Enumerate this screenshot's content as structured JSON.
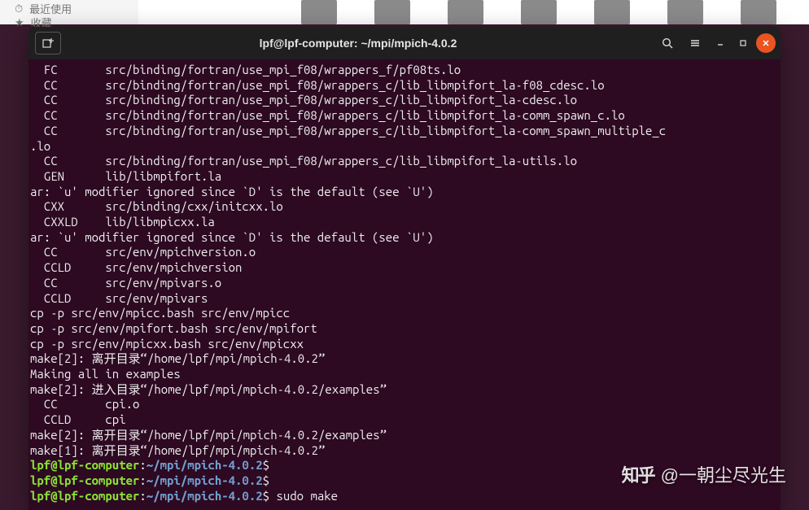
{
  "bg": {
    "sidebar": {
      "recent": "最近使用",
      "fav": "收藏"
    }
  },
  "titlebar": {
    "title": "lpf@lpf-computer: ~/mpi/mpich-4.0.2",
    "newtab_icon": "new-tab-icon",
    "search_icon": "search-icon",
    "menu_icon": "menu-icon",
    "min_icon": "minimize-icon",
    "max_icon": "maximize-icon",
    "close_icon": "close-icon"
  },
  "term": {
    "lines": [
      "  FC       src/binding/fortran/use_mpi_f08/wrappers_f/pf08ts.lo",
      "  CC       src/binding/fortran/use_mpi_f08/wrappers_c/lib_libmpifort_la-f08_cdesc.lo",
      "  CC       src/binding/fortran/use_mpi_f08/wrappers_c/lib_libmpifort_la-cdesc.lo",
      "  CC       src/binding/fortran/use_mpi_f08/wrappers_c/lib_libmpifort_la-comm_spawn_c.lo",
      "  CC       src/binding/fortran/use_mpi_f08/wrappers_c/lib_libmpifort_la-comm_spawn_multiple_c",
      ".lo",
      "  CC       src/binding/fortran/use_mpi_f08/wrappers_c/lib_libmpifort_la-utils.lo",
      "  GEN      lib/libmpifort.la",
      "ar: `u' modifier ignored since `D' is the default (see `U')",
      "  CXX      src/binding/cxx/initcxx.lo",
      "  CXXLD    lib/libmpicxx.la",
      "ar: `u' modifier ignored since `D' is the default (see `U')",
      "  CC       src/env/mpichversion.o",
      "  CCLD     src/env/mpichversion",
      "  CC       src/env/mpivars.o",
      "  CCLD     src/env/mpivars",
      "cp -p src/env/mpicc.bash src/env/mpicc",
      "cp -p src/env/mpifort.bash src/env/mpifort",
      "cp -p src/env/mpicxx.bash src/env/mpicxx",
      "make[2]: 离开目录“/home/lpf/mpi/mpich-4.0.2”",
      "Making all in examples",
      "make[2]: 进入目录“/home/lpf/mpi/mpich-4.0.2/examples”",
      "  CC       cpi.o",
      "  CCLD     cpi",
      "make[2]: 离开目录“/home/lpf/mpi/mpich-4.0.2/examples”",
      "make[1]: 离开目录“/home/lpf/mpi/mpich-4.0.2”"
    ],
    "prompt": {
      "user_host": "lpf@lpf-computer",
      "sep1": ":",
      "path": "~/mpi/mpich-4.0.2",
      "sigil": "$"
    },
    "cmd3": "sudo make"
  },
  "watermark": {
    "logo": "知乎",
    "author": "@一朝尘尽光生"
  }
}
